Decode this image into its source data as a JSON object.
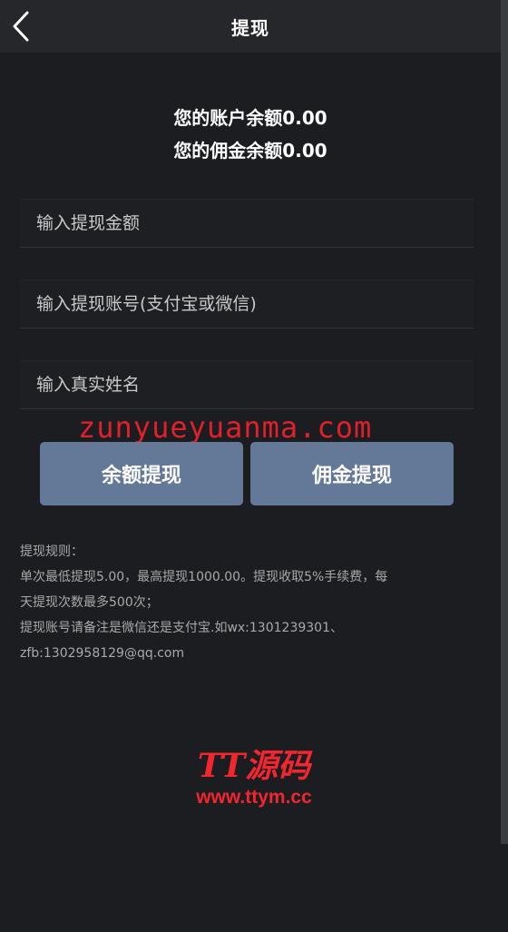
{
  "header": {
    "title": "提现",
    "back_icon": "chevron-left-icon"
  },
  "balances": {
    "account": "您的账户余额0.00",
    "commission": "您的佣金余额0.00"
  },
  "form": {
    "amount_placeholder": "输入提现金额",
    "account_placeholder": "输入提现账号(支付宝或微信)",
    "name_placeholder": "输入真实姓名"
  },
  "watermark_text": "zunyueyuanma.com",
  "buttons": {
    "balance_withdraw": "余额提现",
    "commission_withdraw": "佣金提现"
  },
  "rules": {
    "heading": "提现规则：",
    "line1": "单次最低提现5.00，最高提现1000.00。提现收取5%手续费，每",
    "line2": "天提现次数最多500次；",
    "line3": "提现账号请备注是微信还是支付宝.如wx:1301239301、",
    "line4": "zfb:1302958129@qq.com"
  },
  "logo": {
    "main": "TT源码",
    "sub": "www.ttym.cc"
  },
  "colors": {
    "background": "#1b1d21",
    "header": "#26272b",
    "button": "#647897",
    "watermark": "#e0202a"
  }
}
